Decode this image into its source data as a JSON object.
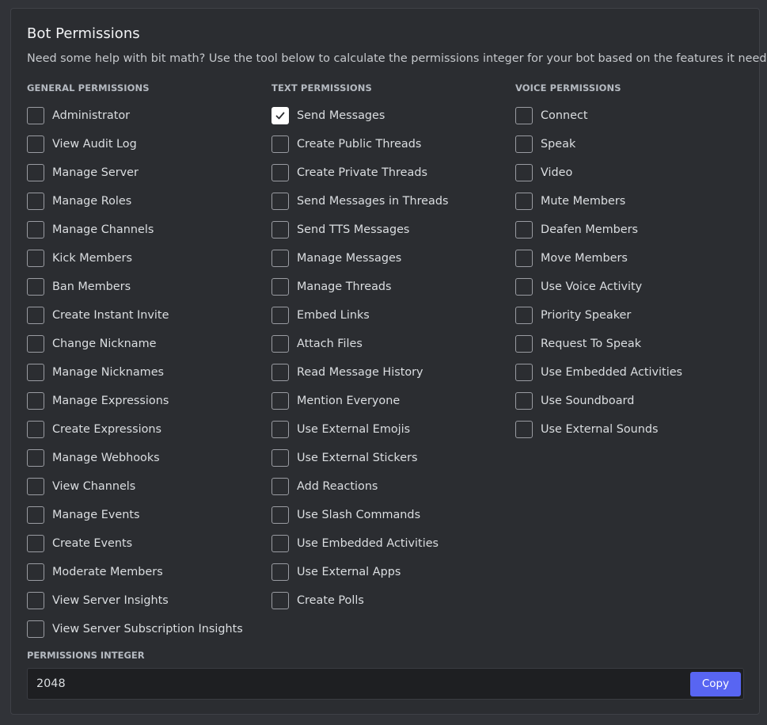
{
  "header": {
    "title": "Bot Permissions",
    "description": "Need some help with bit math? Use the tool below to calculate the permissions integer for your bot based on the features it needs."
  },
  "general": {
    "heading": "GENERAL PERMISSIONS",
    "items": [
      {
        "label": "Administrator",
        "checked": false
      },
      {
        "label": "View Audit Log",
        "checked": false
      },
      {
        "label": "Manage Server",
        "checked": false
      },
      {
        "label": "Manage Roles",
        "checked": false
      },
      {
        "label": "Manage Channels",
        "checked": false
      },
      {
        "label": "Kick Members",
        "checked": false
      },
      {
        "label": "Ban Members",
        "checked": false
      },
      {
        "label": "Create Instant Invite",
        "checked": false
      },
      {
        "label": "Change Nickname",
        "checked": false
      },
      {
        "label": "Manage Nicknames",
        "checked": false
      },
      {
        "label": "Manage Expressions",
        "checked": false
      },
      {
        "label": "Create Expressions",
        "checked": false
      },
      {
        "label": "Manage Webhooks",
        "checked": false
      },
      {
        "label": "View Channels",
        "checked": false
      },
      {
        "label": "Manage Events",
        "checked": false
      },
      {
        "label": "Create Events",
        "checked": false
      },
      {
        "label": "Moderate Members",
        "checked": false
      },
      {
        "label": "View Server Insights",
        "checked": false
      },
      {
        "label": "View Server Subscription Insights",
        "checked": false
      }
    ]
  },
  "text": {
    "heading": "TEXT PERMISSIONS",
    "items": [
      {
        "label": "Send Messages",
        "checked": true
      },
      {
        "label": "Create Public Threads",
        "checked": false
      },
      {
        "label": "Create Private Threads",
        "checked": false
      },
      {
        "label": "Send Messages in Threads",
        "checked": false
      },
      {
        "label": "Send TTS Messages",
        "checked": false
      },
      {
        "label": "Manage Messages",
        "checked": false
      },
      {
        "label": "Manage Threads",
        "checked": false
      },
      {
        "label": "Embed Links",
        "checked": false
      },
      {
        "label": "Attach Files",
        "checked": false
      },
      {
        "label": "Read Message History",
        "checked": false
      },
      {
        "label": "Mention Everyone",
        "checked": false
      },
      {
        "label": "Use External Emojis",
        "checked": false
      },
      {
        "label": "Use External Stickers",
        "checked": false
      },
      {
        "label": "Add Reactions",
        "checked": false
      },
      {
        "label": "Use Slash Commands",
        "checked": false
      },
      {
        "label": "Use Embedded Activities",
        "checked": false
      },
      {
        "label": "Use External Apps",
        "checked": false
      },
      {
        "label": "Create Polls",
        "checked": false
      }
    ]
  },
  "voice": {
    "heading": "VOICE PERMISSIONS",
    "items": [
      {
        "label": "Connect",
        "checked": false
      },
      {
        "label": "Speak",
        "checked": false
      },
      {
        "label": "Video",
        "checked": false
      },
      {
        "label": "Mute Members",
        "checked": false
      },
      {
        "label": "Deafen Members",
        "checked": false
      },
      {
        "label": "Move Members",
        "checked": false
      },
      {
        "label": "Use Voice Activity",
        "checked": false
      },
      {
        "label": "Priority Speaker",
        "checked": false
      },
      {
        "label": "Request To Speak",
        "checked": false
      },
      {
        "label": "Use Embedded Activities",
        "checked": false
      },
      {
        "label": "Use Soundboard",
        "checked": false
      },
      {
        "label": "Use External Sounds",
        "checked": false
      }
    ]
  },
  "integer": {
    "label": "PERMISSIONS INTEGER",
    "value": "2048",
    "copy_label": "Copy"
  },
  "icons": {
    "checkmark": "checkmark-icon"
  },
  "colors": {
    "accent": "#5865f2",
    "background": "#313338",
    "panel": "#2b2d31",
    "field": "#1e1f22"
  }
}
